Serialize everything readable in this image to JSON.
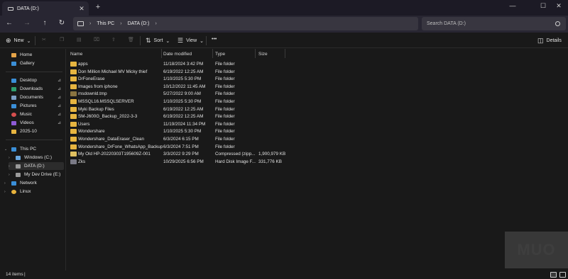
{
  "window": {
    "tab_title": "DATA (D:)",
    "tab_close_glyph": "✕",
    "new_tab_glyph": "+",
    "minimize_glyph": "—",
    "maximize_glyph": "☐",
    "close_glyph": "✕"
  },
  "nav": {
    "back_glyph": "←",
    "forward_glyph": "→",
    "up_glyph": "↑",
    "refresh_glyph": "↻"
  },
  "address": {
    "crumbs": [
      "This PC",
      "DATA (D:)"
    ],
    "separator": "›"
  },
  "search": {
    "placeholder": "Search DATA (D:)"
  },
  "toolbar": {
    "new_label": "New",
    "sort_label": "Sort",
    "view_label": "View",
    "more_label": "•••",
    "details_label": "Details",
    "dropdown_glyph": "⌄"
  },
  "sidebar": {
    "items": [
      {
        "label": "Home",
        "icon": "home-icon",
        "color": "#e5a448"
      },
      {
        "label": "Gallery",
        "icon": "gallery-icon",
        "color": "#3b8fd6"
      },
      {
        "label": "Desktop",
        "icon": "desktop-icon",
        "color": "#3a8fd8",
        "pinned": true
      },
      {
        "label": "Downloads",
        "icon": "downloads-icon",
        "color": "#2f9e6e",
        "pinned": true
      },
      {
        "label": "Documents",
        "icon": "documents-icon",
        "color": "#7c9fc4",
        "pinned": true
      },
      {
        "label": "Pictures",
        "icon": "pictures-icon",
        "color": "#3a8fd8",
        "pinned": true
      },
      {
        "label": "Music",
        "icon": "music-icon",
        "color": "#d64f4f",
        "pinned": true
      },
      {
        "label": "Videos",
        "icon": "videos-icon",
        "color": "#8e5bd6",
        "pinned": true
      },
      {
        "label": "2025-10",
        "icon": "folder-icon",
        "color": "#e7b540"
      },
      {
        "label": "This PC",
        "icon": "this-pc-icon",
        "color": "#3a8fd8"
      },
      {
        "label": "Windows (C:)",
        "icon": "drive-c-icon",
        "color": "#6aa8e0"
      },
      {
        "label": "DATA (D:)",
        "icon": "drive-d-icon",
        "color": "#9a9a9a"
      },
      {
        "label": "My Dev Drive (E:)",
        "icon": "drive-e-icon",
        "color": "#9a9a9a"
      },
      {
        "label": "Network",
        "icon": "network-icon",
        "color": "#3a8fd8"
      },
      {
        "label": "Linux",
        "icon": "linux-icon",
        "color": "#e8b33c"
      }
    ],
    "pin_glyph": "📌",
    "chevron_glyph": "›",
    "chevron_open_glyph": "⌄"
  },
  "columns": {
    "name": "Name",
    "date": "Date modified",
    "type": "Type",
    "size": "Size",
    "sort_glyph": "⌃"
  },
  "files": [
    {
      "name": "apps",
      "date": "11/18/2024 3:42 PM",
      "type": "File folder",
      "size": "",
      "kind": "folder"
    },
    {
      "name": "Don Million Michael MV Micky thief",
      "date": "6/19/2022 12:25 AM",
      "type": "File folder",
      "size": "",
      "kind": "folder"
    },
    {
      "name": "DrFoneErase",
      "date": "1/10/2025 5:30 PM",
      "type": "File folder",
      "size": "",
      "kind": "folder"
    },
    {
      "name": "Images from iphone",
      "date": "10/12/2022 11:45 AM",
      "type": "File folder",
      "size": "",
      "kind": "folder"
    },
    {
      "name": "msdownld.tmp",
      "date": "5/27/2022 9:00 AM",
      "type": "File folder",
      "size": "",
      "kind": "hidden"
    },
    {
      "name": "MSSQL16.MSSQLSERVER",
      "date": "1/10/2025 5:30 PM",
      "type": "File folder",
      "size": "",
      "kind": "folder"
    },
    {
      "name": "Myki Backup Files",
      "date": "6/19/2022 12:25 AM",
      "type": "File folder",
      "size": "",
      "kind": "folder"
    },
    {
      "name": "SM-J600G_Backup_2022-3-3",
      "date": "6/19/2022 12:25 AM",
      "type": "File folder",
      "size": "",
      "kind": "folder"
    },
    {
      "name": "Users",
      "date": "11/19/2024 11:34 PM",
      "type": "File folder",
      "size": "",
      "kind": "folder"
    },
    {
      "name": "Wondershare",
      "date": "1/10/2025 5:30 PM",
      "type": "File folder",
      "size": "",
      "kind": "folder"
    },
    {
      "name": "Wondershare_DataEraser_Clean",
      "date": "6/3/2024 6:15 PM",
      "type": "File folder",
      "size": "",
      "kind": "folder"
    },
    {
      "name": "Wondershare_DrFone_WhatsApp_Backup",
      "date": "6/3/2024 7:51 PM",
      "type": "File folder",
      "size": "",
      "kind": "folder"
    },
    {
      "name": "My Old HP-20220303T195609Z-001",
      "date": "3/3/2022 9:29 PM",
      "type": "Compressed (zipp...",
      "size": "1,900,979 KB",
      "kind": "zip"
    },
    {
      "name": "Zks",
      "date": "10/29/2025 6:56 PM",
      "type": "Hard Disk Image F...",
      "size": "331,776 KB",
      "kind": "vhd"
    }
  ],
  "status": {
    "item_count": "14 items",
    "cursor": "|"
  },
  "watermark": {
    "text": "MUO"
  }
}
